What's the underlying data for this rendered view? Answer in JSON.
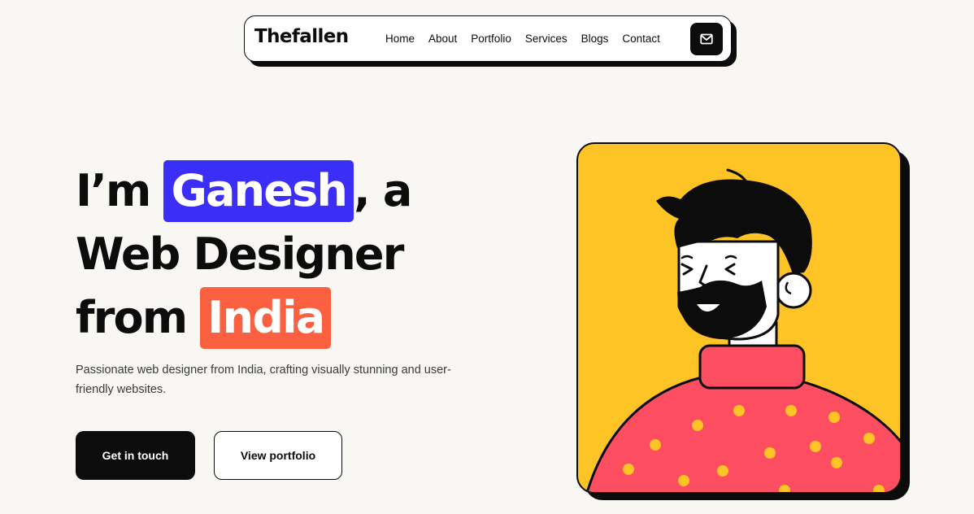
{
  "nav": {
    "brand": "Thefallen",
    "items": [
      {
        "label": "Home"
      },
      {
        "label": "About"
      },
      {
        "label": "Portfolio"
      },
      {
        "label": "Services"
      },
      {
        "label": "Blogs"
      },
      {
        "label": "Contact"
      }
    ],
    "mail_icon": "mail-icon"
  },
  "hero": {
    "line1_prefix": "I’m",
    "name": "Ganesh",
    "line1_suffix": ", a",
    "line2": "Web Designer",
    "line3_prefix": "from",
    "country": "India",
    "description": "Passionate web designer from India, crafting visually stunning and user-friendly websites.",
    "primary_button": "Get in touch",
    "secondary_button": "View portfolio"
  },
  "colors": {
    "background": "#f9f7f3",
    "ink": "#0c0c0c",
    "name_highlight": "#3b2ef6",
    "country_highlight": "#fb6140",
    "illustration_bg": "#fec324",
    "sweater": "#fd4d60",
    "dots": "#fec324"
  },
  "illustration": {
    "subject": "bearded-man-avatar"
  }
}
